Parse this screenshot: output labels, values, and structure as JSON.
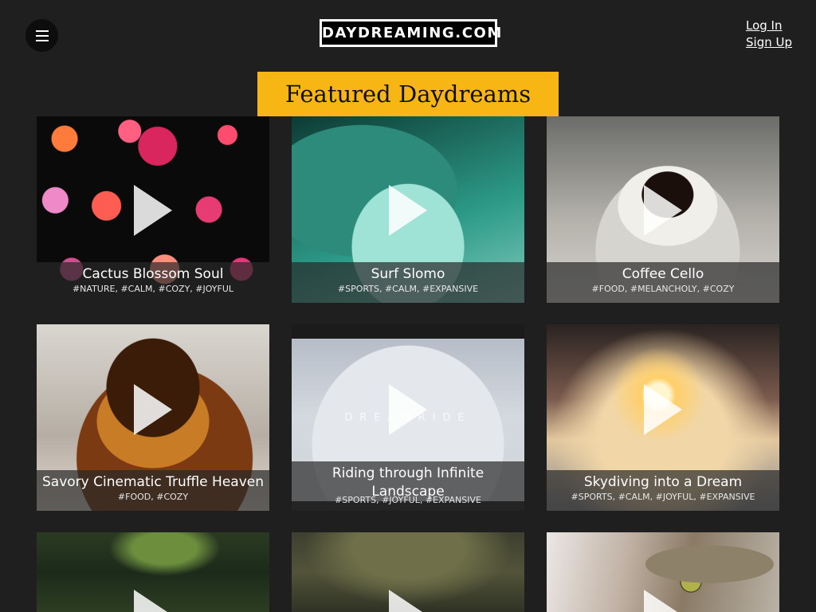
{
  "header": {
    "logo": "DAYDREAMING.COM",
    "login": "Log In",
    "signup": "Sign Up"
  },
  "featured": "Featured Daydreams",
  "cards": [
    {
      "title": "Cactus Blossom Soul",
      "tags": "#NATURE, #CALM, #COZY, #JOYFUL"
    },
    {
      "title": "Surf Slomo",
      "tags": "#SPORTS, #CALM, #EXPANSIVE"
    },
    {
      "title": "Coffee Cello",
      "tags": "#FOOD, #MELANCHOLY, #COZY"
    },
    {
      "title": "Savory Cinematic Truffle Heaven",
      "tags": "#FOOD, #COZY"
    },
    {
      "title": "Riding through Infinite Landscape",
      "tags": "#SPORTS, #JOYFUL, #EXPANSIVE",
      "overlay_text": "DREAMRIDE"
    },
    {
      "title": "Skydiving into a Dream",
      "tags": "#SPORTS, #CALM, #JOYFUL, #EXPANSIVE"
    }
  ],
  "icons": {
    "menu": "hamburger-menu-icon",
    "play": "play-icon"
  }
}
